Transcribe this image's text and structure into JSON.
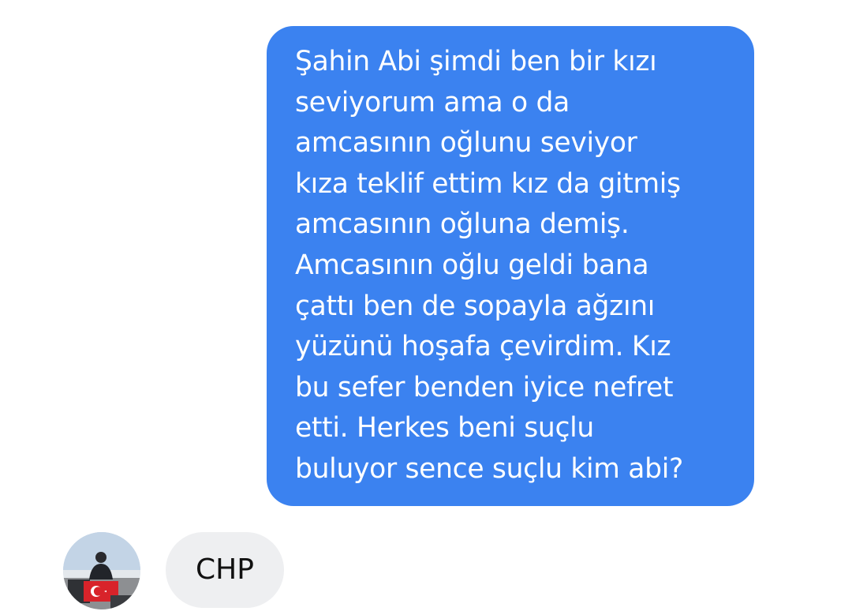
{
  "conversation": {
    "sent_message": {
      "lines": [
        "Şahin Abi şimdi ben bir kızı",
        "seviyorum ama o da",
        "amcasının oğlunu seviyor",
        "kıza teklif ettim kız da gitmiş",
        "amcasının oğluna demiş.",
        "Amcasının oğlu geldi bana",
        "çattı ben de sopayla ağzını",
        "yüzünü hoşafa çevirdim. Kız",
        "bu sefer benden iyice nefret",
        "etti. Herkes beni suçlu",
        "buluyor sence suçlu kim abi?"
      ]
    },
    "received_message": {
      "text": "CHP"
    }
  },
  "colors": {
    "sent_bubble": "#3b82f0",
    "received_bubble": "#eeeff1",
    "background": "#ffffff"
  }
}
